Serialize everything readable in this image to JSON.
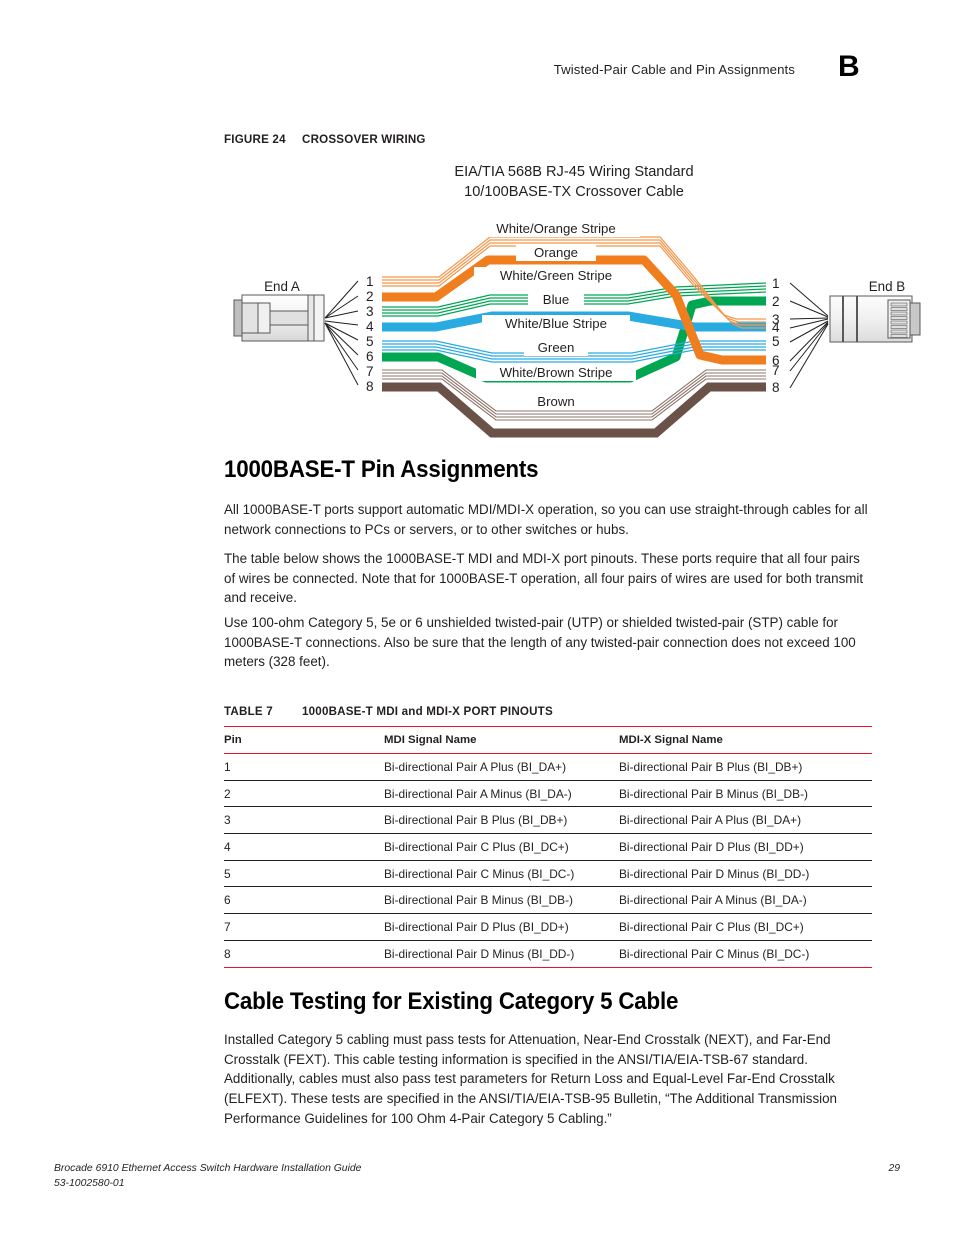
{
  "header": {
    "running_title": "Twisted-Pair Cable and Pin Assignments",
    "appendix_letter": "B"
  },
  "figure": {
    "label": "FIGURE 24",
    "caption": "CROSSOVER WIRING",
    "title_line1": "EIA/TIA 568B RJ-45 Wiring Standard",
    "title_line2": "10/100BASE-TX Crossover Cable",
    "end_a_label": "End A",
    "end_b_label": "End B",
    "pin_numbers": [
      "1",
      "2",
      "3",
      "4",
      "5",
      "6",
      "7",
      "8"
    ],
    "wire_labels": [
      "White/Orange Stripe",
      "Orange",
      "White/Green Stripe",
      "Blue",
      "White/Blue Stripe",
      "Green",
      "White/Brown Stripe",
      "Brown"
    ],
    "colors": {
      "orange": "#F07D1E",
      "green": "#00A651",
      "blue": "#29ABE2",
      "brown": "#6B5248",
      "connector_body": "#EDEDED",
      "connector_stroke": "#58595B"
    },
    "crossover_map": [
      {
        "a": 1,
        "b": 3,
        "wire": "White/Orange Stripe"
      },
      {
        "a": 2,
        "b": 6,
        "wire": "Orange"
      },
      {
        "a": 3,
        "b": 1,
        "wire": "White/Green Stripe"
      },
      {
        "a": 4,
        "b": 4,
        "wire": "Blue"
      },
      {
        "a": 5,
        "b": 5,
        "wire": "White/Blue Stripe"
      },
      {
        "a": 6,
        "b": 2,
        "wire": "Green"
      },
      {
        "a": 7,
        "b": 7,
        "wire": "White/Brown Stripe"
      },
      {
        "a": 8,
        "b": 8,
        "wire": "Brown"
      }
    ]
  },
  "sections": {
    "pin_assignments_heading": "1000BASE-T Pin Assignments",
    "p1": "All 1000BASE-T ports support automatic MDI/MDI-X operation, so you can use straight-through cables for all network connections to PCs or servers, or to other switches or hubs.",
    "p2": "The table below shows the 1000BASE-T MDI and MDI-X port pinouts. These ports require that all four pairs of wires be connected. Note that for 1000BASE-T operation, all four pairs of wires are used for both transmit and receive.",
    "p3": "Use 100-ohm Category 5, 5e or 6 unshielded twisted-pair (UTP) or shielded twisted-pair (STP) cable for 1000BASE-T connections. Also be sure that the length of any twisted-pair connection does not exceed 100 meters (328 feet).",
    "cable_testing_heading": "Cable Testing for Existing Category 5 Cable",
    "p4": "Installed Category 5 cabling must pass tests for Attenuation, Near-End Crosstalk (NEXT), and Far-End Crosstalk (FEXT). This cable testing information is specified in the ANSI/TIA/EIA-TSB-67 standard. Additionally, cables must also pass test parameters for Return Loss and Equal-Level Far-End Crosstalk (ELFEXT). These tests are specified in the ANSI/TIA/EIA-TSB-95 Bulletin, “The Additional Transmission Performance Guidelines for 100 Ohm 4-Pair Category 5 Cabling.”"
  },
  "table": {
    "label": "TABLE 7",
    "caption": "1000BASE-T MDI and MDI-X PORT PINOUTS",
    "columns": [
      "Pin",
      "MDI Signal Name",
      "MDI-X Signal Name"
    ],
    "rows": [
      [
        "1",
        "Bi-directional Pair A Plus (BI_DA+)",
        "Bi-directional Pair B Plus (BI_DB+)"
      ],
      [
        "2",
        "Bi-directional Pair A Minus (BI_DA-)",
        "Bi-directional Pair B Minus (BI_DB-)"
      ],
      [
        "3",
        "Bi-directional Pair B Plus (BI_DB+)",
        "Bi-directional Pair A Plus (BI_DA+)"
      ],
      [
        "4",
        "Bi-directional Pair C Plus (BI_DC+)",
        "Bi-directional Pair D Plus (BI_DD+)"
      ],
      [
        "5",
        "Bi-directional Pair C Minus (BI_DC-)",
        "Bi-directional Pair D Minus (BI_DD-)"
      ],
      [
        "6",
        "Bi-directional Pair B Minus (BI_DB-)",
        "Bi-directional Pair A Minus (BI_DA-)"
      ],
      [
        "7",
        "Bi-directional Pair D Plus (BI_DD+)",
        "Bi-directional Pair C Plus (BI_DC+)"
      ],
      [
        "8",
        "Bi-directional Pair D Minus (BI_DD-)",
        "Bi-directional Pair C Minus (BI_DC-)"
      ]
    ]
  },
  "footer": {
    "guide_title": "Brocade 6910 Ethernet Access Switch Hardware Installation Guide",
    "doc_number": "53-1002580-01",
    "page_number": "29"
  }
}
